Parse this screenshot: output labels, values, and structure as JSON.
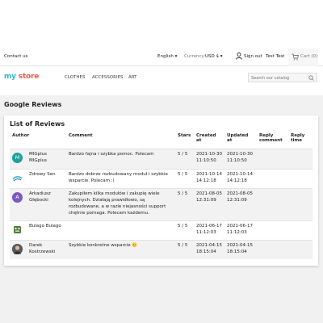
{
  "topbar": {
    "contact_label": "Contact us",
    "language": "English ▾",
    "currency_label": "Currency:",
    "currency_value": "USD $ ▾",
    "signout_label": "Sign out",
    "user_name": "Test Test",
    "cart_label": "Cart (0)"
  },
  "header": {
    "logo_part1": "my",
    "logo_part2": "store",
    "nav": [
      "CLOTHES",
      "ACCESSORIES",
      "ART"
    ],
    "search_placeholder": "Search our catalog"
  },
  "page_title": "Google Reviews",
  "list_title": "List of Reviews",
  "columns": [
    "Author",
    "Comment",
    "Stars",
    "Created at",
    "Updated at",
    "Reply comment",
    "Reply time"
  ],
  "reviews": [
    {
      "author": "MIGplus MIGplus",
      "avatar": "M",
      "avatar_color": "#1ea09a",
      "comment": "Bardzo fajna i szybka pomoc. Polecam",
      "stars": "5 / 5",
      "created": "2021-10-30 11:10:50",
      "updated": "2021-10-30 11:10:50",
      "reply_comment": "",
      "reply_time": ""
    },
    {
      "author": "Zdrowy Sen",
      "avatar": "",
      "avatar_color": "#ffffff",
      "comment": "Bardzo dobrze rozbudowany moduł i szybkie wsparcie. Polecam :)",
      "stars": "5 / 5",
      "created": "2021-10-14 14:12:18",
      "updated": "2021-10-14 14:12:18",
      "reply_comment": "",
      "reply_time": ""
    },
    {
      "author": "Arkadiusz Głębocki",
      "avatar": "A",
      "avatar_color": "#7e57c2",
      "comment": "Zakupiłem kilka modułów i zakupię wiele kolejnych. Działają prawidłowo, są rozbudowane, a w razie niejasności support chętnie pomaga. Polecam każdemu.",
      "stars": "5 / 5",
      "created": "2021-08-05 12:31:09",
      "updated": "2021-08-05 12:31:09",
      "reply_comment": "",
      "reply_time": ""
    },
    {
      "author": "Bulago Bulago",
      "avatar": "",
      "avatar_color": "#4f7d3a",
      "comment": "",
      "stars": "5 / 5",
      "created": "2021-06-17 11:12:03",
      "updated": "2021-06-17 11:12:03",
      "reply_comment": "",
      "reply_time": ""
    },
    {
      "author": "Darek Kostrzewski",
      "avatar": "",
      "avatar_color": "#444444",
      "comment": "Szybkie konkretne wsparcie 🙂",
      "stars": "5 / 5",
      "created": "2021-04-15 18:15:04",
      "updated": "2021-04-15 18:15:04",
      "reply_comment": "",
      "reply_time": ""
    }
  ]
}
